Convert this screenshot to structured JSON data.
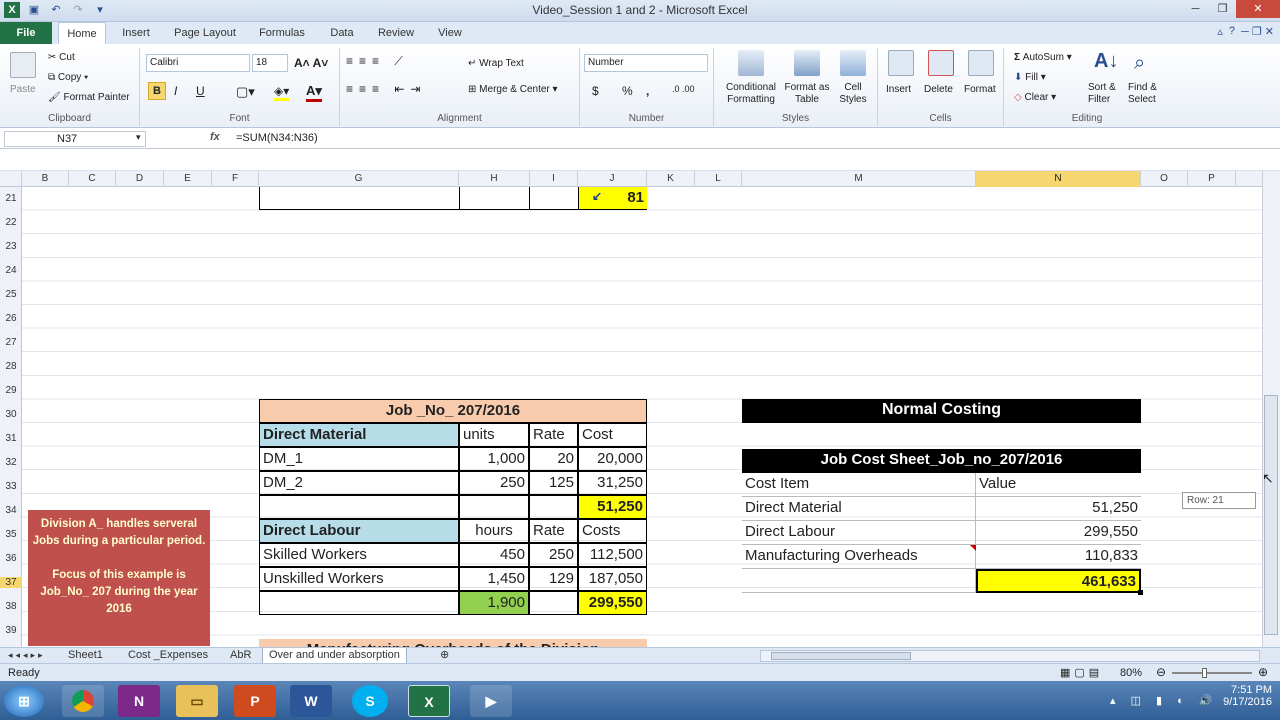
{
  "window": {
    "title": "Video_Session 1 and 2  -  Microsoft Excel"
  },
  "colors": {
    "accent": "#217346",
    "highlight_yellow": "#ffff00",
    "peach": "#f8cbad",
    "lightblue": "#b7dde8",
    "green": "#92d050",
    "red_note": "#c0504d"
  },
  "ribbon": {
    "tabs": [
      "File",
      "Home",
      "Insert",
      "Page Layout",
      "Formulas",
      "Data",
      "Review",
      "View"
    ],
    "clipboard": {
      "paste": "Paste",
      "cut": "Cut",
      "copy": "Copy",
      "painter": "Format Painter",
      "name": "Clipboard"
    },
    "font": {
      "family": "Calibri",
      "size": "18",
      "name": "Font",
      "bold": "B",
      "italic": "I",
      "underline": "U"
    },
    "alignment": {
      "wrap": "Wrap Text",
      "merge": "Merge & Center",
      "name": "Alignment"
    },
    "number": {
      "format": "Number",
      "currency": "$",
      "percent": "%",
      "comma": ",",
      "name": "Number"
    },
    "styles": {
      "conditional": "Conditional Formatting",
      "format_table": "Format as Table",
      "cell_styles": "Cell Styles",
      "name": "Styles"
    },
    "cells": {
      "insert": "Insert",
      "delete": "Delete",
      "format": "Format",
      "name": "Cells"
    },
    "editing": {
      "autosum": "AutoSum",
      "fill": "Fill",
      "clear": "Clear",
      "sort": "Sort & Filter",
      "find": "Find & Select",
      "name": "Editing"
    }
  },
  "formula_bar": {
    "name_box": "N37",
    "fx": "fx",
    "formula": "=SUM(N34:N36)"
  },
  "columns": [
    "B",
    "C",
    "D",
    "E",
    "F",
    "G",
    "H",
    "I",
    "J",
    "K",
    "L",
    "M",
    "N",
    "O",
    "P"
  ],
  "rows": [
    "21",
    "22",
    "23",
    "24",
    "25",
    "26",
    "27",
    "28",
    "29",
    "30",
    "31",
    "32",
    "33",
    "34",
    "35",
    "36",
    "37",
    "38",
    "39"
  ],
  "cells": {
    "j21": "81",
    "job_title": "Job _No_ 207/2016",
    "dm_header": "Direct  Material",
    "units": "units",
    "rate1": "Rate",
    "cost": "Cost",
    "dm1": "DM_1",
    "dm1_units": "1,000",
    "dm1_rate": "20",
    "dm1_cost": "20,000",
    "dm2": "DM_2",
    "dm2_units": "250",
    "dm2_rate": "125",
    "dm2_cost": "31,250",
    "dm_total": "51,250",
    "dl_header": "Direct Labour",
    "hours": "hours",
    "rate2": "Rate",
    "costs": "Costs",
    "skilled": "Skilled Workers",
    "skilled_hours": "450",
    "skilled_rate": "250",
    "skilled_cost": "112,500",
    "unskilled": "Unskilled Workers",
    "unskilled_hours": "1,450",
    "unskilled_rate": "129",
    "unskilled_cost": "187,050",
    "hours_total": "1,900",
    "dl_total": "299,550",
    "normal_costing": "Normal Costing",
    "jcs_title": "Job Cost Sheet_Job_no_207/2016",
    "cost_item": "Cost Item",
    "value": "Value",
    "jcs_dm": "Direct Material",
    "jcs_dm_val": "51,250",
    "jcs_dl": "Direct Labour",
    "jcs_dl_val": "299,550",
    "jcs_moh": "Manufacturing Overheads",
    "jcs_moh_val": "110,833",
    "jcs_total": "461,633",
    "note": "Division A_ handles serveral Jobs during a particular period.\n\nFocus of this example is Job_No_ 207 during the year 2016",
    "partial_row40": "Manufacturing Overheads of the Division"
  },
  "tooltip": "Row: 21",
  "sheets": [
    "Sheet1",
    "Cost _Expenses",
    "AbR",
    "Over and under absorption"
  ],
  "status": {
    "ready": "Ready",
    "zoom": "80%"
  },
  "taskbar": {
    "time": "7:51 PM",
    "date": "9/17/2016"
  }
}
